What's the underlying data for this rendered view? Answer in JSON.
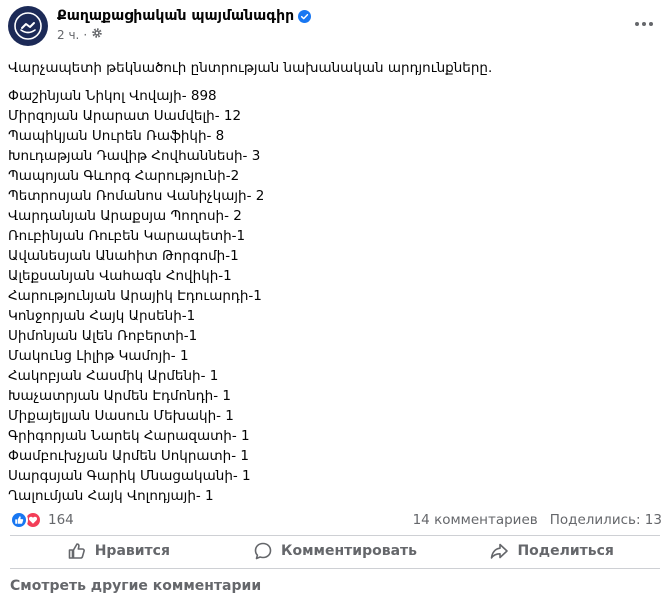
{
  "post": {
    "page_name": "Քաղաքացիական պայմանագիր",
    "time": "2 ч.",
    "intro": "Վարչապետի թեկնածուի ընտրության նախանական արդյունքները.",
    "lines": [
      "Փաշինյան Նիկոլ Վովայի- 898",
      "Միրզոյան Արարատ Սամվելի- 12",
      "Պապիկյան Սուրեն Ռաֆիկի- 8",
      "Խուդաթյան Դավիթ Հովհաննեսի- 3",
      "Պապոյան Գևորգ Հարությունի-2",
      "Պետրոսյան Ռոմանոս Վանիչկայի- 2",
      "Վարդանյան Արաքսյա Պողոսի- 2",
      "Ռուբինյան Ռուբեն Կարապետի-1",
      "Ավանեսյան Անահիտ Թորգոմի-1",
      "Ալեքսանյան Վահագն Հովիկի-1",
      "Հարությունյան Արայիկ Էդուարդի-1",
      "Կոնջորյան Հայկ Արսենի-1",
      "Սիմոնյան Ալեն Ռոբերտի-1",
      "Մակունց Լիլիթ Կամոյի- 1",
      "Հակոբյան Հասմիկ Արմենի- 1",
      "Խաչատրյան Արմեն Էդմոնդի- 1",
      "Միքայելյան Սասուն Մեխակի- 1",
      "Գրիգորյան Նարեկ Հարազատի- 1",
      "Փամբուխչյան Արմեն Սոկրատի- 1",
      "Սարգսյան Գարիկ Մնացականի- 1",
      "Ղալումյան Հայկ Վոլոդյայի- 1"
    ]
  },
  "reactions": {
    "count": "164",
    "comments": "14 комментариев",
    "shares": "Поделились: 13"
  },
  "actions": {
    "like": "Нравится",
    "comment": "Комментировать",
    "share": "Поделиться"
  },
  "more_comments": "Смотреть другие комментарии",
  "colors": {
    "accent": "#1877f2",
    "love": "#f33e58",
    "secondary_text": "#65676b",
    "avatar_bg": "#1c2a57"
  },
  "icons": {
    "verified": "verified-badge-icon",
    "audience": "settings-gear-icon",
    "more": "more-horizontal-icon",
    "like": "thumbs-up-icon",
    "comment": "comment-bubble-icon",
    "share": "share-arrow-icon"
  }
}
